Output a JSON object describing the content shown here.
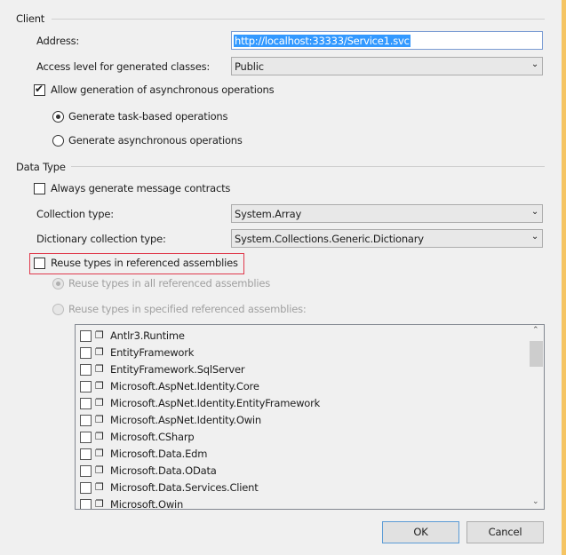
{
  "client": {
    "heading": "Client",
    "address_label": "Address:",
    "address_value": "http://localhost:33333/Service1.svc",
    "access_label": "Access level for generated classes:",
    "access_value": "Public",
    "async_label": "Allow generation of asynchronous operations",
    "async_checked": true,
    "task_label": "Generate task-based operations",
    "task_selected": true,
    "asyncops_label": "Generate asynchronous operations",
    "asyncops_selected": false
  },
  "data_type": {
    "heading": "Data Type",
    "msg_label": "Always generate message contracts",
    "msg_checked": false,
    "collection_label": "Collection type:",
    "collection_value": "System.Array",
    "dict_label": "Dictionary collection type:",
    "dict_value": "System.Collections.Generic.Dictionary",
    "reuse_label": "Reuse types in referenced assemblies",
    "reuse_checked": false,
    "reuse_all_label": "Reuse types in all referenced assemblies",
    "reuse_specified_label": "Reuse types in specified referenced assemblies:"
  },
  "assemblies": [
    "Antlr3.Runtime",
    "EntityFramework",
    "EntityFramework.SqlServer",
    "Microsoft.AspNet.Identity.Core",
    "Microsoft.AspNet.Identity.EntityFramework",
    "Microsoft.AspNet.Identity.Owin",
    "Microsoft.CSharp",
    "Microsoft.Data.Edm",
    "Microsoft.Data.OData",
    "Microsoft.Data.Services.Client",
    "Microsoft.Owin"
  ],
  "buttons": {
    "ok": "OK",
    "cancel": "Cancel"
  },
  "colors": {
    "highlight_box": "#e0394c",
    "selection": "#3399ff",
    "window_border": "#f5c463"
  }
}
